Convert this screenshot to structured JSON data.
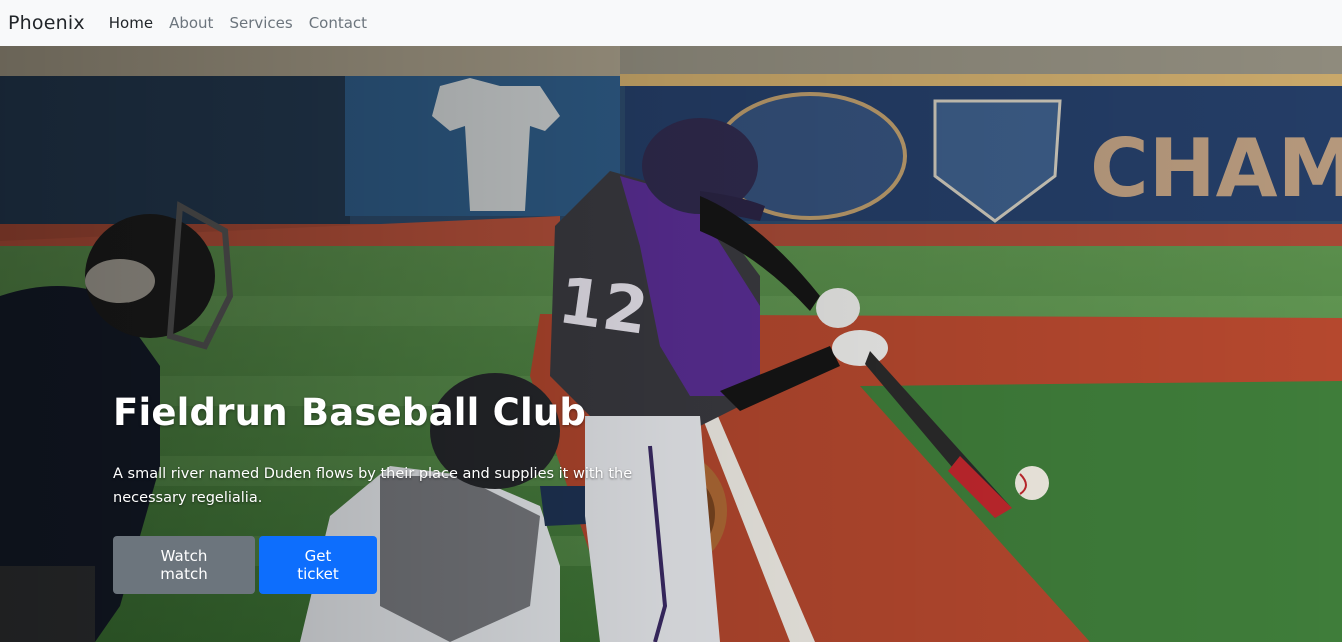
{
  "navbar": {
    "brand": "Phoenix",
    "links": [
      {
        "label": "Home",
        "active": true
      },
      {
        "label": "About",
        "active": false
      },
      {
        "label": "Services",
        "active": false
      },
      {
        "label": "Contact",
        "active": false
      }
    ]
  },
  "hero": {
    "title": "Fieldrun Baseball Club",
    "text": "A small river named Duden flows by their place and supplies it with the necessary regelialia.",
    "buttons": {
      "watch": "Watch match",
      "ticket": "Get ticket"
    },
    "image": {
      "subject": "baseball-batter-catcher-umpire-photo",
      "batter_number": "12"
    }
  },
  "colors": {
    "navbar_bg": "#f8f9fa",
    "primary": "#0d6efd",
    "secondary": "#6c757d",
    "field_green": "#3f7d3a",
    "infield_red": "#b5482e",
    "wall_blue": "#1f3b63"
  }
}
